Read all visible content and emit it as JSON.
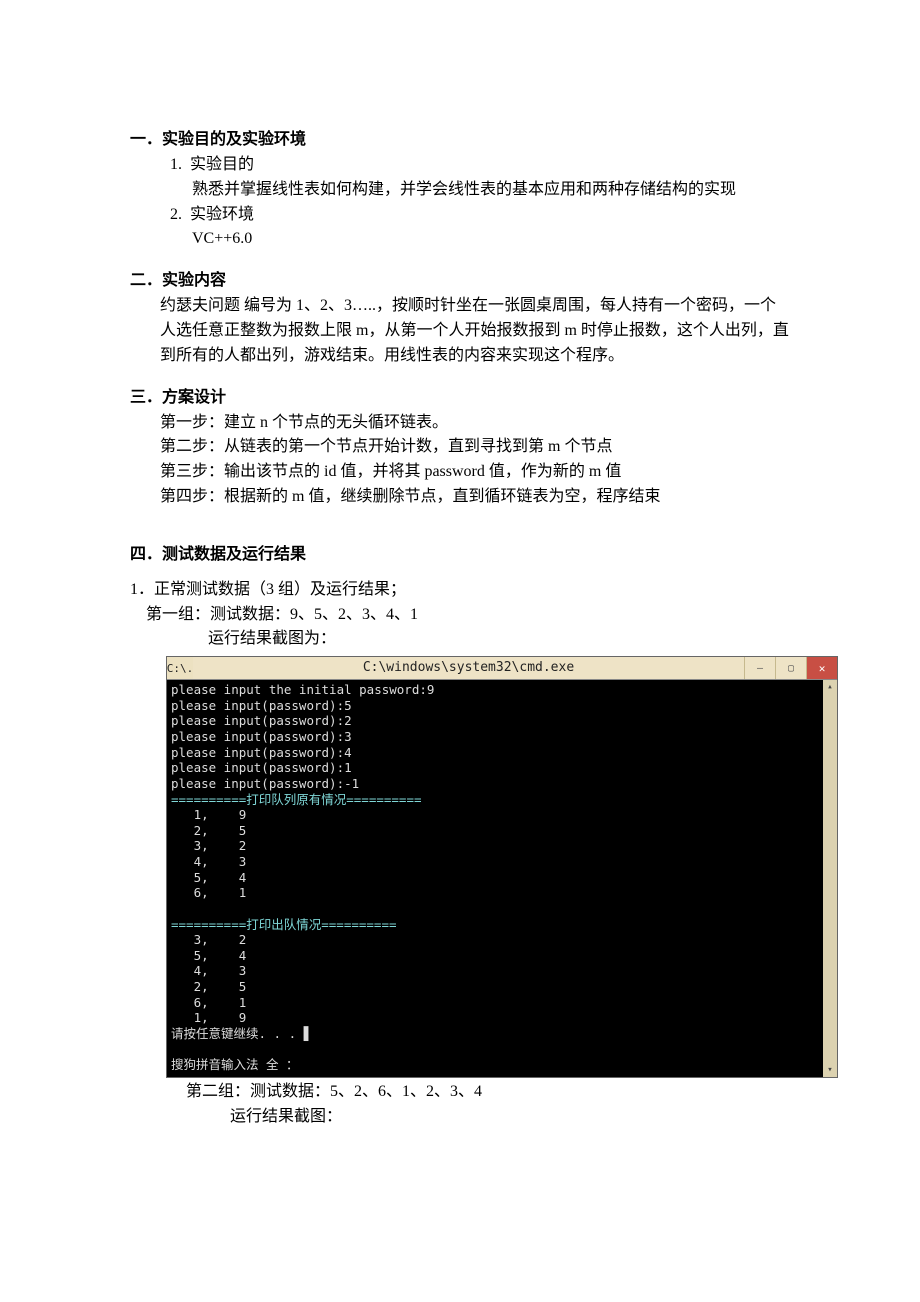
{
  "s1": {
    "heading": "一．实验目的及实验环境",
    "i1n": "1.",
    "i1t": "实验目的",
    "i1body": "熟悉并掌握线性表如何构建，并学会线性表的基本应用和两种存储结构的实现",
    "i2n": "2.",
    "i2t": "实验环境",
    "i2body": "VC++6.0"
  },
  "s2": {
    "heading": "二．实验内容",
    "body": "约瑟夫问题 编号为 1、2、3…..，按顺时针坐在一张圆桌周围，每人持有一个密码，一个人选任意正整数为报数上限 m，从第一个人开始报数报到 m 时停止报数，这个人出列，直到所有的人都出列，游戏结束。用线性表的内容来实现这个程序。"
  },
  "s3": {
    "heading": "三．方案设计",
    "l1": "第一步：建立 n 个节点的无头循环链表。",
    "l2": "第二步：从链表的第一个节点开始计数，直到寻找到第 m 个节点",
    "l3": "第三步：输出该节点的 id 值，并将其 password 值，作为新的 m 值",
    "l4": "第四步：根据新的 m 值，继续删除节点，直到循环链表为空，程序结束"
  },
  "s4": {
    "heading": "四．测试数据及运行结果",
    "t1": "1．正常测试数据（3 组）及运行结果；",
    "g1a": "第一组：测试数据：9、5、2、3、4、1",
    "g1b": "运行结果截图为：",
    "g2a": "第二组：测试数据：5、2、6、1、2、3、4",
    "g2b": "运行结果截图："
  },
  "cmd": {
    "icon": "C:\\.",
    "title": "C:\\windows\\system32\\cmd.exe",
    "lines_top": "please input the initial password:9\nplease input(password):5\nplease input(password):2\nplease input(password):3\nplease input(password):4\nplease input(password):1\nplease input(password):-1",
    "banner1": "==========打印队列原有情况==========",
    "table1": "   1,    9\n   2,    5\n   3,    2\n   4,    3\n   5,    4\n   6,    1",
    "banner2": "==========打印出队情况==========",
    "table2": "   3,    2\n   5,    4\n   4,    3\n   2,    5\n   6,    1\n   1,    9",
    "press": "请按任意键继续. . . ▋",
    "ime": "搜狗拼音输入法 全 ："
  }
}
